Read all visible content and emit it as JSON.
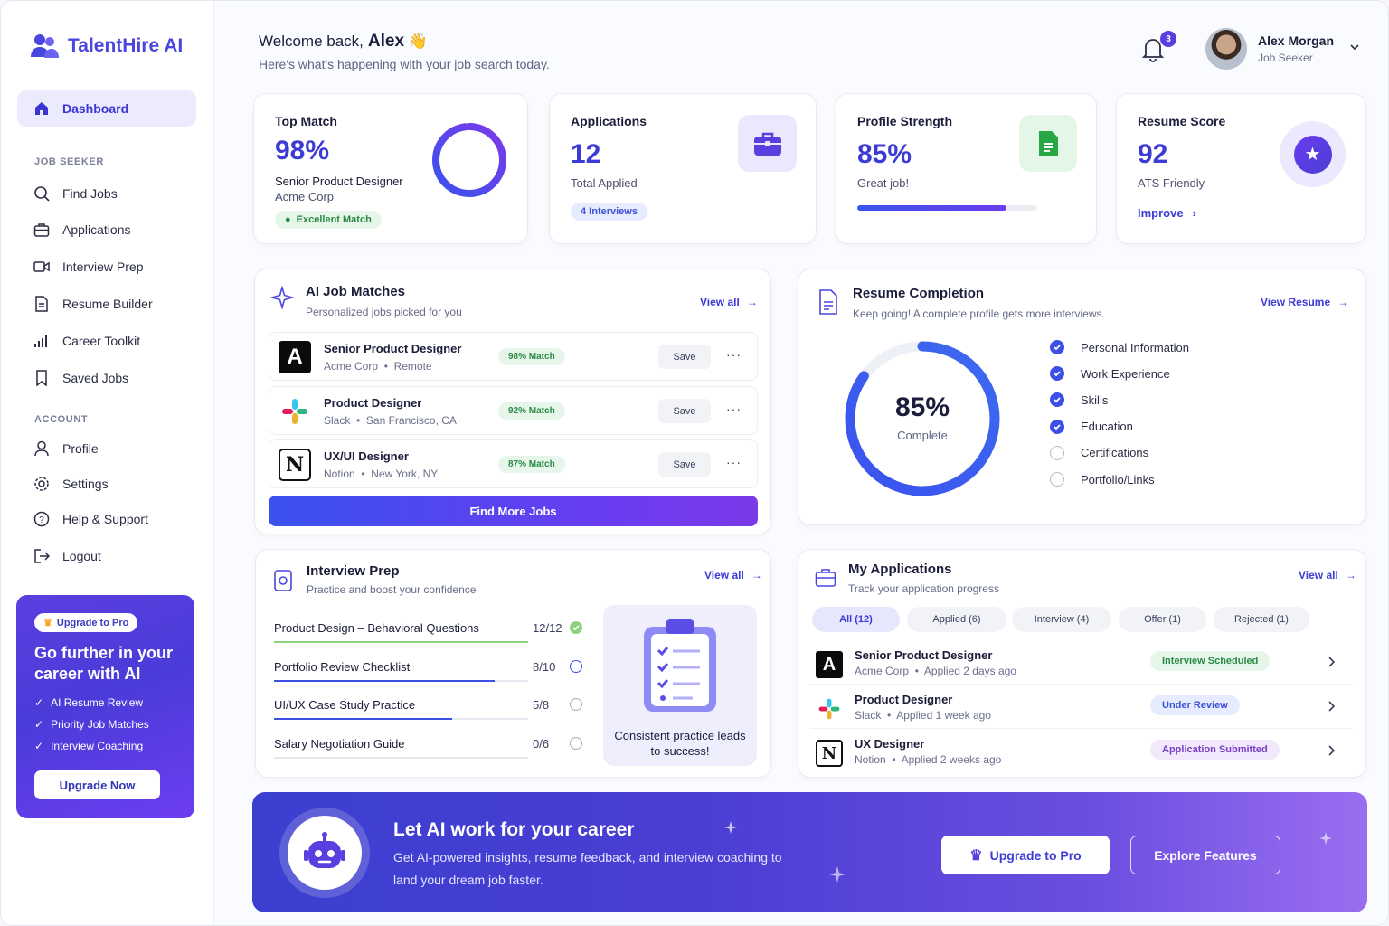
{
  "brand": {
    "name": "TalentHire AI"
  },
  "sidebar": {
    "dashboard": "Dashboard",
    "section_job": "JOB SEEKER",
    "job_items": [
      "Find Jobs",
      "Applications",
      "Interview Prep",
      "Resume Builder",
      "Career Toolkit",
      "Saved Jobs"
    ],
    "section_account": "ACCOUNT",
    "account_items": [
      "Profile",
      "Settings",
      "Help & Support",
      "Logout"
    ]
  },
  "promo": {
    "badge": "Upgrade to Pro",
    "title": "Go further in your career with AI",
    "features": [
      "AI Resume Review",
      "Priority Job Matches",
      "Interview Coaching"
    ],
    "button": "Upgrade Now"
  },
  "header": {
    "welcome": "Welcome back,",
    "name": "Alex",
    "subtitle": "Here's what's happening with your job search today.",
    "notifications": "3",
    "user_name": "Alex Morgan",
    "user_role": "Job Seeker"
  },
  "stats": {
    "top_match": {
      "label": "Top Match",
      "value": "98%",
      "role": "Senior Product Designer",
      "company": "Acme Corp",
      "badge": "Excellent Match",
      "ring": 0.98
    },
    "applications": {
      "label": "Applications",
      "value": "12",
      "sub": "Total Applied",
      "badge": "4 Interviews"
    },
    "profile": {
      "label": "Profile Strength",
      "value": "85%",
      "sub": "Great job!",
      "progress": 0.83
    },
    "resume": {
      "label": "Resume Score",
      "value": "92",
      "sub": "ATS Friendly",
      "link": "Improve"
    }
  },
  "ai_matches": {
    "title": "AI Job Matches",
    "subtitle": "Personalized jobs picked for you",
    "view_all": "View all",
    "jobs": [
      {
        "title": "Senior Product Designer",
        "company": "Acme Corp",
        "location": "Remote",
        "match": "98% Match",
        "save": "Save"
      },
      {
        "title": "Product Designer",
        "company": "Slack",
        "location": "San Francisco, CA",
        "match": "92% Match",
        "save": "Save"
      },
      {
        "title": "UX/UI Designer",
        "company": "Notion",
        "location": "New York, NY",
        "match": "87% Match",
        "save": "Save"
      }
    ],
    "button": "Find More Jobs"
  },
  "resume_completion": {
    "title": "Resume Completion",
    "subtitle": "Keep going! A complete profile gets more interviews.",
    "view": "View Resume",
    "percent": "85%",
    "percent_value": 0.85,
    "label": "Complete",
    "items": [
      {
        "name": "Personal Information",
        "done": true
      },
      {
        "name": "Work Experience",
        "done": true
      },
      {
        "name": "Skills",
        "done": true
      },
      {
        "name": "Education",
        "done": true
      },
      {
        "name": "Certifications",
        "done": false
      },
      {
        "name": "Portfolio/Links",
        "done": false
      }
    ]
  },
  "interview_prep": {
    "title": "Interview Prep",
    "subtitle": "Practice and boost your confidence",
    "view_all": "View all",
    "items": [
      {
        "name": "Product Design – Behavioral Questions",
        "count": "12/12",
        "progress": 1.0,
        "state": "done"
      },
      {
        "name": "Portfolio Review Checklist",
        "count": "8/10",
        "progress": 0.87,
        "state": "active"
      },
      {
        "name": "UI/UX Case Study Practice",
        "count": "5/8",
        "progress": 0.7,
        "state": "todo"
      },
      {
        "name": "Salary Negotiation Guide",
        "count": "0/6",
        "progress": 0,
        "state": "todo"
      }
    ],
    "tip": "Consistent practice leads to success!"
  },
  "my_applications": {
    "title": "My Applications",
    "subtitle": "Track your application progress",
    "view_all": "View all",
    "tabs": [
      "All (12)",
      "Applied (6)",
      "Interview (4)",
      "Offer (1)",
      "Rejected (1)"
    ],
    "rows": [
      {
        "title": "Senior Product Designer",
        "company": "Acme Corp",
        "when": "Applied 2 days ago",
        "status": "Interview Scheduled",
        "color": "#2a8a44",
        "bg": "#e6f6ea"
      },
      {
        "title": "Product Designer",
        "company": "Slack",
        "when": "Applied 1 week ago",
        "status": "Under Review",
        "color": "#3d50d6",
        "bg": "#e6ebfd"
      },
      {
        "title": "UX Designer",
        "company": "Notion",
        "when": "Applied 2 weeks ago",
        "status": "Application Submitted",
        "color": "#7a3cc8",
        "bg": "#f1e8fc"
      }
    ]
  },
  "banner": {
    "title": "Let AI work for your career",
    "subtitle": "Get AI-powered insights, resume feedback, and interview coaching to land your dream job faster.",
    "primary": "Upgrade to Pro",
    "secondary": "Explore Features"
  },
  "colors": {
    "accent": "#3d3bd6",
    "purple": "#6a3cf0",
    "green": "#2a8a44"
  }
}
